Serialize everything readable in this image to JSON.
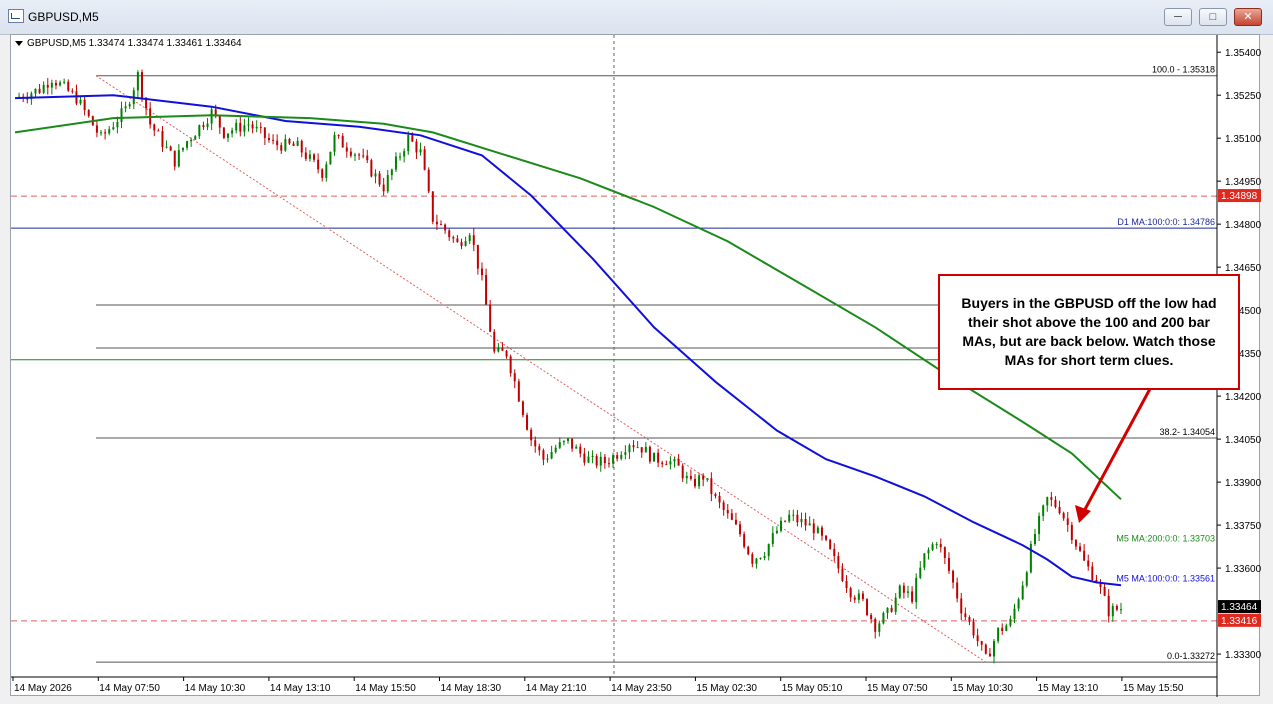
{
  "window": {
    "title": "GBPUSD,M5",
    "buttons": {
      "minimize": "─",
      "maximize": "□",
      "close": "✕"
    }
  },
  "chart_header": {
    "symbol_line": "GBPUSD,M5  1.33474 1.33474 1.33461 1.33464"
  },
  "price_axis": {
    "ticks": [
      "1.35400",
      "1.35250",
      "1.35100",
      "1.34950",
      "1.34800",
      "1.34650",
      "1.34500",
      "1.34350",
      "1.34200",
      "1.34050",
      "1.33900",
      "1.33750",
      "1.33600",
      "1.33300"
    ],
    "tick_values": [
      1.354,
      1.3525,
      1.351,
      1.3495,
      1.348,
      1.3465,
      1.345,
      1.3435,
      1.342,
      1.3405,
      1.339,
      1.3375,
      1.336,
      1.333
    ],
    "badges": [
      {
        "text": "1.34898",
        "value": 1.34898,
        "bg": "#e0281e",
        "fg": "#ffffff"
      },
      {
        "text": "1.33464",
        "value": 1.33464,
        "bg": "#000000",
        "fg": "#ffffff"
      },
      {
        "text": "1.33416",
        "value": 1.33416,
        "bg": "#e0281e",
        "fg": "#ffffff"
      }
    ]
  },
  "time_axis": {
    "labels": [
      "14 May 2026",
      "14 May 07:50",
      "14 May 10:30",
      "14 May 13:10",
      "14 May 15:50",
      "14 May 18:30",
      "14 May 21:10",
      "14 May 23:50",
      "15 May 02:30",
      "15 May 05:10",
      "15 May 07:50",
      "15 May 10:30",
      "15 May 13:10",
      "15 May 15:50"
    ]
  },
  "levels": {
    "fib_100": {
      "label": "100.0 - 1.35318",
      "value": 1.35318
    },
    "fib_38": {
      "label": "38.2- 1.34054",
      "value": 1.34054
    },
    "fib_0": {
      "label": "0.0-1.33272",
      "value": 1.33272
    },
    "fib_other": [
      1.34518,
      1.34368
    ],
    "d1_ma": {
      "label": "D1 MA:100:0:0: 1.34786",
      "value": 1.34786
    },
    "green_level": 1.34327,
    "red_high": 1.34898,
    "red_low": 1.33416
  },
  "ma_labels": {
    "ma200": "M5 MA:200:0:0: 1.33703",
    "ma100": "M5 MA:100:0:0: 1.33561"
  },
  "callout": {
    "text": "Buyers in the GBPUSD off the low had their shot above the 100 and 200 bar MAs, but are back below.  Watch those MAs for short term clues."
  },
  "colors": {
    "bull": "#008000",
    "bear": "#c00000",
    "ma100": "#1010dd",
    "ma200": "#1a8a1a",
    "level_blue": "#1a2a9a",
    "level_green": "#1a8a1a",
    "red_dash": "#e06060",
    "grey_line": "#555555"
  },
  "chart_data": {
    "type": "candlestick",
    "symbol": "GBPUSD",
    "timeframe": "M5",
    "ylim": [
      1.3322,
      1.3546
    ],
    "close_path": [
      [
        0,
        1.3524
      ],
      [
        2,
        1.3527
      ],
      [
        3,
        1.3531
      ],
      [
        5,
        1.3524
      ],
      [
        7,
        1.351
      ],
      [
        9,
        1.352
      ],
      [
        10,
        1.3532
      ],
      [
        11,
        1.3515
      ],
      [
        13,
        1.3502
      ],
      [
        14,
        1.3509
      ],
      [
        16,
        1.3519
      ],
      [
        17,
        1.3512
      ],
      [
        19,
        1.3515
      ],
      [
        21,
        1.3508
      ],
      [
        23,
        1.3507
      ],
      [
        25,
        1.3498
      ],
      [
        26,
        1.351
      ],
      [
        28,
        1.3504
      ],
      [
        30,
        1.3493
      ],
      [
        32,
        1.351
      ],
      [
        33,
        1.3505
      ],
      [
        34,
        1.3482
      ],
      [
        35,
        1.3478
      ],
      [
        36,
        1.3473
      ],
      [
        37,
        1.3478
      ],
      [
        38,
        1.346
      ],
      [
        39,
        1.3435
      ],
      [
        40,
        1.3435
      ],
      [
        41,
        1.342
      ],
      [
        42,
        1.3405
      ],
      [
        43,
        1.3398
      ],
      [
        44,
        1.3402
      ],
      [
        45,
        1.3404
      ],
      [
        46,
        1.34
      ],
      [
        47,
        1.3397
      ],
      [
        48,
        1.3397
      ],
      [
        49,
        1.34
      ],
      [
        50,
        1.3404
      ],
      [
        51,
        1.3402
      ],
      [
        52,
        1.3398
      ],
      [
        53,
        1.3398
      ],
      [
        54,
        1.3395
      ],
      [
        55,
        1.3389
      ],
      [
        56,
        1.3392
      ],
      [
        57,
        1.3384
      ],
      [
        58,
        1.3378
      ],
      [
        59,
        1.3372
      ],
      [
        60,
        1.3363
      ],
      [
        61,
        1.3366
      ],
      [
        62,
        1.3373
      ],
      [
        63,
        1.3378
      ],
      [
        64,
        1.3376
      ],
      [
        65,
        1.3374
      ],
      [
        66,
        1.3368
      ],
      [
        67,
        1.336
      ],
      [
        68,
        1.3352
      ],
      [
        69,
        1.3348
      ],
      [
        70,
        1.334
      ],
      [
        71,
        1.3344
      ],
      [
        72,
        1.3352
      ],
      [
        73,
        1.335
      ],
      [
        74,
        1.3364
      ],
      [
        75,
        1.337
      ],
      [
        76,
        1.3359
      ],
      [
        77,
        1.3346
      ],
      [
        78,
        1.3338
      ],
      [
        79,
        1.3328
      ],
      [
        80,
        1.3338
      ],
      [
        81,
        1.3341
      ],
      [
        82,
        1.3355
      ],
      [
        83,
        1.3372
      ],
      [
        84,
        1.3384
      ],
      [
        85,
        1.3381
      ],
      [
        86,
        1.3372
      ],
      [
        87,
        1.3362
      ],
      [
        88,
        1.3356
      ],
      [
        89,
        1.3345
      ],
      [
        90,
        1.3346
      ]
    ],
    "series": [
      {
        "name": "M5 MA:100:0:0",
        "values": [
          [
            0,
            1.3524
          ],
          [
            8,
            1.3525
          ],
          [
            16,
            1.3521
          ],
          [
            22,
            1.3516
          ],
          [
            28,
            1.3514
          ],
          [
            33,
            1.3511
          ],
          [
            38,
            1.3504
          ],
          [
            42,
            1.349
          ],
          [
            47,
            1.3468
          ],
          [
            52,
            1.3444
          ],
          [
            57,
            1.3425
          ],
          [
            62,
            1.3408
          ],
          [
            66,
            1.3398
          ],
          [
            70,
            1.3392
          ],
          [
            74,
            1.3385
          ],
          [
            78,
            1.3376
          ],
          [
            80,
            1.3372
          ],
          [
            82,
            1.3368
          ],
          [
            84,
            1.3363
          ],
          [
            86,
            1.3357
          ],
          [
            88,
            1.3355
          ],
          [
            90,
            1.3354
          ]
        ]
      },
      {
        "name": "M5 MA:200:0:0",
        "values": [
          [
            0,
            1.3512
          ],
          [
            8,
            1.3517
          ],
          [
            16,
            1.3518
          ],
          [
            24,
            1.3517
          ],
          [
            30,
            1.3515
          ],
          [
            34,
            1.3512
          ],
          [
            40,
            1.3504
          ],
          [
            46,
            1.3496
          ],
          [
            52,
            1.3486
          ],
          [
            58,
            1.3474
          ],
          [
            64,
            1.3459
          ],
          [
            70,
            1.3444
          ],
          [
            76,
            1.3427
          ],
          [
            82,
            1.3411
          ],
          [
            86,
            1.34
          ],
          [
            88,
            1.3392
          ],
          [
            90,
            1.3384
          ]
        ]
      }
    ]
  }
}
